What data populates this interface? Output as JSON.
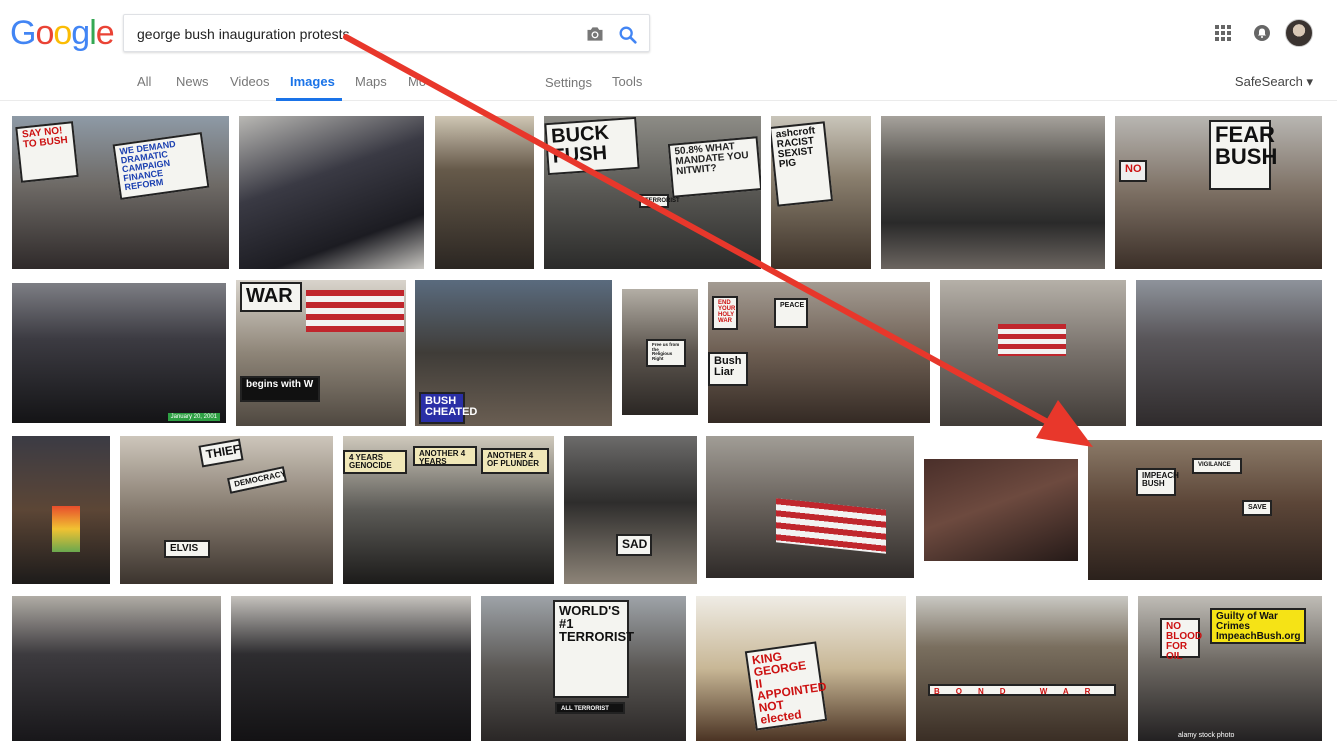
{
  "logo": {
    "letters": [
      "G",
      "o",
      "o",
      "g",
      "l",
      "e"
    ],
    "colors": [
      "#4285F4",
      "#EA4335",
      "#FBBC05",
      "#4285F4",
      "#34A853",
      "#EA4335"
    ]
  },
  "search": {
    "query": "george bush inauguration protests"
  },
  "tabs": {
    "all": "All",
    "news": "News",
    "videos": "Videos",
    "images": "Images",
    "maps": "Maps",
    "more": "Mo",
    "settings": "Settings",
    "tools": "Tools"
  },
  "safesearch": "SafeSearch ▾",
  "icons": {
    "camera": "camera-icon",
    "search": "search-icon",
    "apps": "apps-grid-icon",
    "notifications": "notifications-icon"
  },
  "accent": "#1a73e8",
  "arrow_color": "#e8372b",
  "thumbs": {
    "t1": {
      "sign1": "SAY NO! TO BUSH",
      "sign2": "WE DEMAND DRAMATIC CAMPAIGN FINANCE REFORM"
    },
    "t4": {
      "sign1": "BUCK FUSH",
      "sign2": "50.8% WHAT MANDATE YOU NITWIT?",
      "sign3": "TERRORIST"
    },
    "t5": {
      "sign1": "ashcroft RACIST SEXIST PIG"
    },
    "t7": {
      "sign1": "FEAR BUSH",
      "sign2": "NO"
    },
    "t8": {
      "stamp": "January 20, 2001"
    },
    "t9": {
      "sign1": "WAR",
      "sign2": "begins with W"
    },
    "t10": {
      "sign1": "BUSH CHEATED"
    },
    "t11": {
      "sign1": "Free us from the Religious Right"
    },
    "t12": {
      "sign1": "Bush Liar",
      "sign2": "END YOUR HOLY WAR",
      "sign3": "PEACE"
    },
    "t16": {
      "sign1": "THIEF",
      "sign2": "DEMOCRACY",
      "sign3": "ELVIS"
    },
    "t17": {
      "sign1": "4 YEARS GENOCIDE",
      "sign2": "ANOTHER 4 YEARS",
      "sign3": "ANOTHER 4 OF PLUNDER"
    },
    "t18": {
      "sign1": "SAD"
    },
    "t21": {
      "sign1": "IMPEACH BUSH",
      "sign2": "VIGILANCE",
      "sign3": "SAVE"
    },
    "t24": {
      "sign1": "WORLD'S #1 TERRORIST",
      "sign2": "ALL TERRORIST"
    },
    "t25": {
      "sign1": "KING GEORGE II APPOINTED NOT elected"
    },
    "t26": {
      "sign1": "BOND WAR"
    },
    "t27": {
      "sign1": "Guilty of War Crimes ImpeachBush.org",
      "sign2": "NO BLOOD FOR OIL",
      "stamp": "alamy stock photo"
    }
  }
}
